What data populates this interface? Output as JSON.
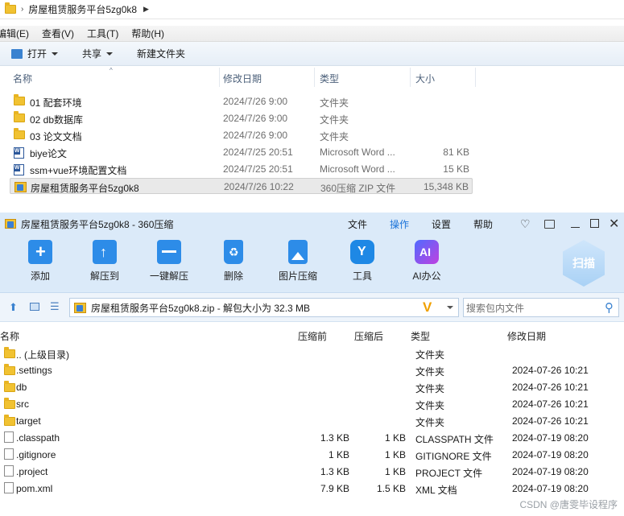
{
  "explorer": {
    "breadcrumb": "房屋租赁服务平台5zg0k8",
    "menu": [
      "编辑(E)",
      "查看(V)",
      "工具(T)",
      "帮助(H)"
    ],
    "toolbar": {
      "open": "打开",
      "share": "共享",
      "new_folder": "新建文件夹"
    },
    "columns": {
      "name": "名称",
      "modified": "修改日期",
      "type": "类型",
      "size": "大小"
    },
    "files": [
      {
        "name": "01 配套环境",
        "modified": "2024/7/26 9:00",
        "type": "文件夹",
        "size": "",
        "icon": "folder-icon"
      },
      {
        "name": "02 db数据库",
        "modified": "2024/7/26 9:00",
        "type": "文件夹",
        "size": "",
        "icon": "folder-icon"
      },
      {
        "name": "03 论文文档",
        "modified": "2024/7/26 9:00",
        "type": "文件夹",
        "size": "",
        "icon": "folder-icon"
      },
      {
        "name": "biye论文",
        "modified": "2024/7/25 20:51",
        "type": "Microsoft Word ...",
        "size": "81 KB",
        "icon": "word-icon"
      },
      {
        "name": "ssm+vue环境配置文档",
        "modified": "2024/7/25 20:51",
        "type": "Microsoft Word ...",
        "size": "15 KB",
        "icon": "word-icon"
      },
      {
        "name": "房屋租赁服务平台5zg0k8",
        "modified": "2024/7/26 10:22",
        "type": "360压缩 ZIP 文件",
        "size": "15,348 KB",
        "icon": "zip-icon",
        "selected": true
      }
    ]
  },
  "zip": {
    "title": "房屋租赁服务平台5zg0k8 - 360压缩",
    "menu": [
      "文件",
      "操作",
      "设置",
      "帮助"
    ],
    "active_menu": "操作",
    "tools": [
      {
        "label": "添加",
        "icon": "add-icon"
      },
      {
        "label": "解压到",
        "icon": "extract-to-icon"
      },
      {
        "label": "一键解压",
        "icon": "one-click-extract-icon"
      },
      {
        "label": "删除",
        "icon": "delete-icon"
      },
      {
        "label": "图片压缩",
        "icon": "image-compress-icon"
      },
      {
        "label": "工具",
        "icon": "tools-icon"
      },
      {
        "label": "AI办公",
        "icon": "ai-office-icon"
      }
    ],
    "scan_label": "扫描",
    "path": "房屋租赁服务平台5zg0k8.zip - 解包大小为 32.3 MB",
    "search_placeholder": "搜索包内文件",
    "columns": {
      "name": "名称",
      "before": "压缩前",
      "after": "压缩后",
      "type": "类型",
      "modified": "修改日期"
    },
    "entries": [
      {
        "name": ".. (上级目录)",
        "before": "",
        "after": "",
        "type": "文件夹",
        "modified": "",
        "icon": "folder-icon"
      },
      {
        "name": ".settings",
        "before": "",
        "after": "",
        "type": "文件夹",
        "modified": "2024-07-26 10:21",
        "icon": "folder-icon"
      },
      {
        "name": "db",
        "before": "",
        "after": "",
        "type": "文件夹",
        "modified": "2024-07-26 10:21",
        "icon": "folder-icon"
      },
      {
        "name": "src",
        "before": "",
        "after": "",
        "type": "文件夹",
        "modified": "2024-07-26 10:21",
        "icon": "folder-icon"
      },
      {
        "name": "target",
        "before": "",
        "after": "",
        "type": "文件夹",
        "modified": "2024-07-26 10:21",
        "icon": "folder-icon"
      },
      {
        "name": ".classpath",
        "before": "1.3 KB",
        "after": "1 KB",
        "type": "CLASSPATH 文件",
        "modified": "2024-07-19 08:20",
        "icon": "file-icon"
      },
      {
        "name": ".gitignore",
        "before": "1 KB",
        "after": "1 KB",
        "type": "GITIGNORE 文件",
        "modified": "2024-07-19 08:20",
        "icon": "file-icon"
      },
      {
        "name": ".project",
        "before": "1.3 KB",
        "after": "1 KB",
        "type": "PROJECT 文件",
        "modified": "2024-07-19 08:20",
        "icon": "file-icon"
      },
      {
        "name": "pom.xml",
        "before": "7.9 KB",
        "after": "1.5 KB",
        "type": "XML 文档",
        "modified": "2024-07-19 08:20",
        "icon": "xml-file-icon"
      }
    ]
  },
  "watermark": "CSDN @唐雯毕设程序"
}
